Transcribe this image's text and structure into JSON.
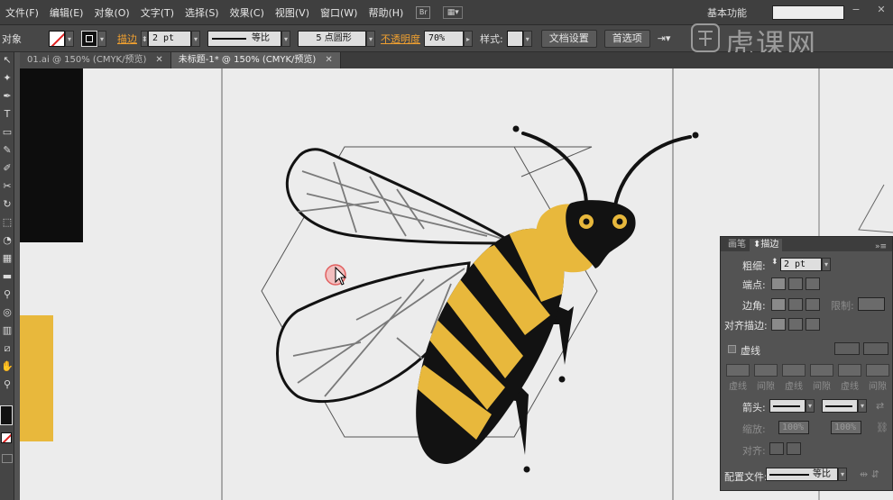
{
  "menu": [
    "文件(F)",
    "编辑(E)",
    "对象(O)",
    "文字(T)",
    "选择(S)",
    "效果(C)",
    "视图(V)",
    "窗口(W)",
    "帮助(H)"
  ],
  "bridge_label": "Br",
  "workspace_label": "基本功能",
  "control": {
    "left_label": "对象",
    "stroke_label": "描边",
    "stroke_value": "2 pt",
    "profile_label": "等比",
    "brush_label": "5 点圆形",
    "opacity_label": "不透明度",
    "opacity_value": "70%",
    "style_label": "样式:",
    "doc_setup": "文档设置",
    "preferences": "首选项"
  },
  "tabs": [
    "01.ai @ 150% (CMYK/预览)",
    "未标题-1* @ 150% (CMYK/预览)"
  ],
  "panel": {
    "tabs": [
      "画笔",
      "描边"
    ],
    "weight_label": "粗细:",
    "weight_value": "2 pt",
    "cap_label": "端点:",
    "corner_label": "边角:",
    "limit_label": "限制:",
    "align_label": "对齐描边:",
    "dashed_label": "虚线",
    "dash_labels": [
      "虚线",
      "间隙",
      "虚线",
      "间隙",
      "虚线",
      "间隙"
    ],
    "arrow_label": "箭头:",
    "scale_label": "缩放:",
    "scale_values": [
      "100%",
      "100%"
    ],
    "align2_label": "对齐:",
    "profile_label": "配置文件:",
    "profile_value": "等比"
  },
  "watermark": "虎课网",
  "colors": {
    "bee_yellow": "#e8b83c",
    "bee_black": "#121212",
    "canvas": "#ececec",
    "ui_dark": "#3f3f3f",
    "accent_orange": "#f0a030"
  }
}
